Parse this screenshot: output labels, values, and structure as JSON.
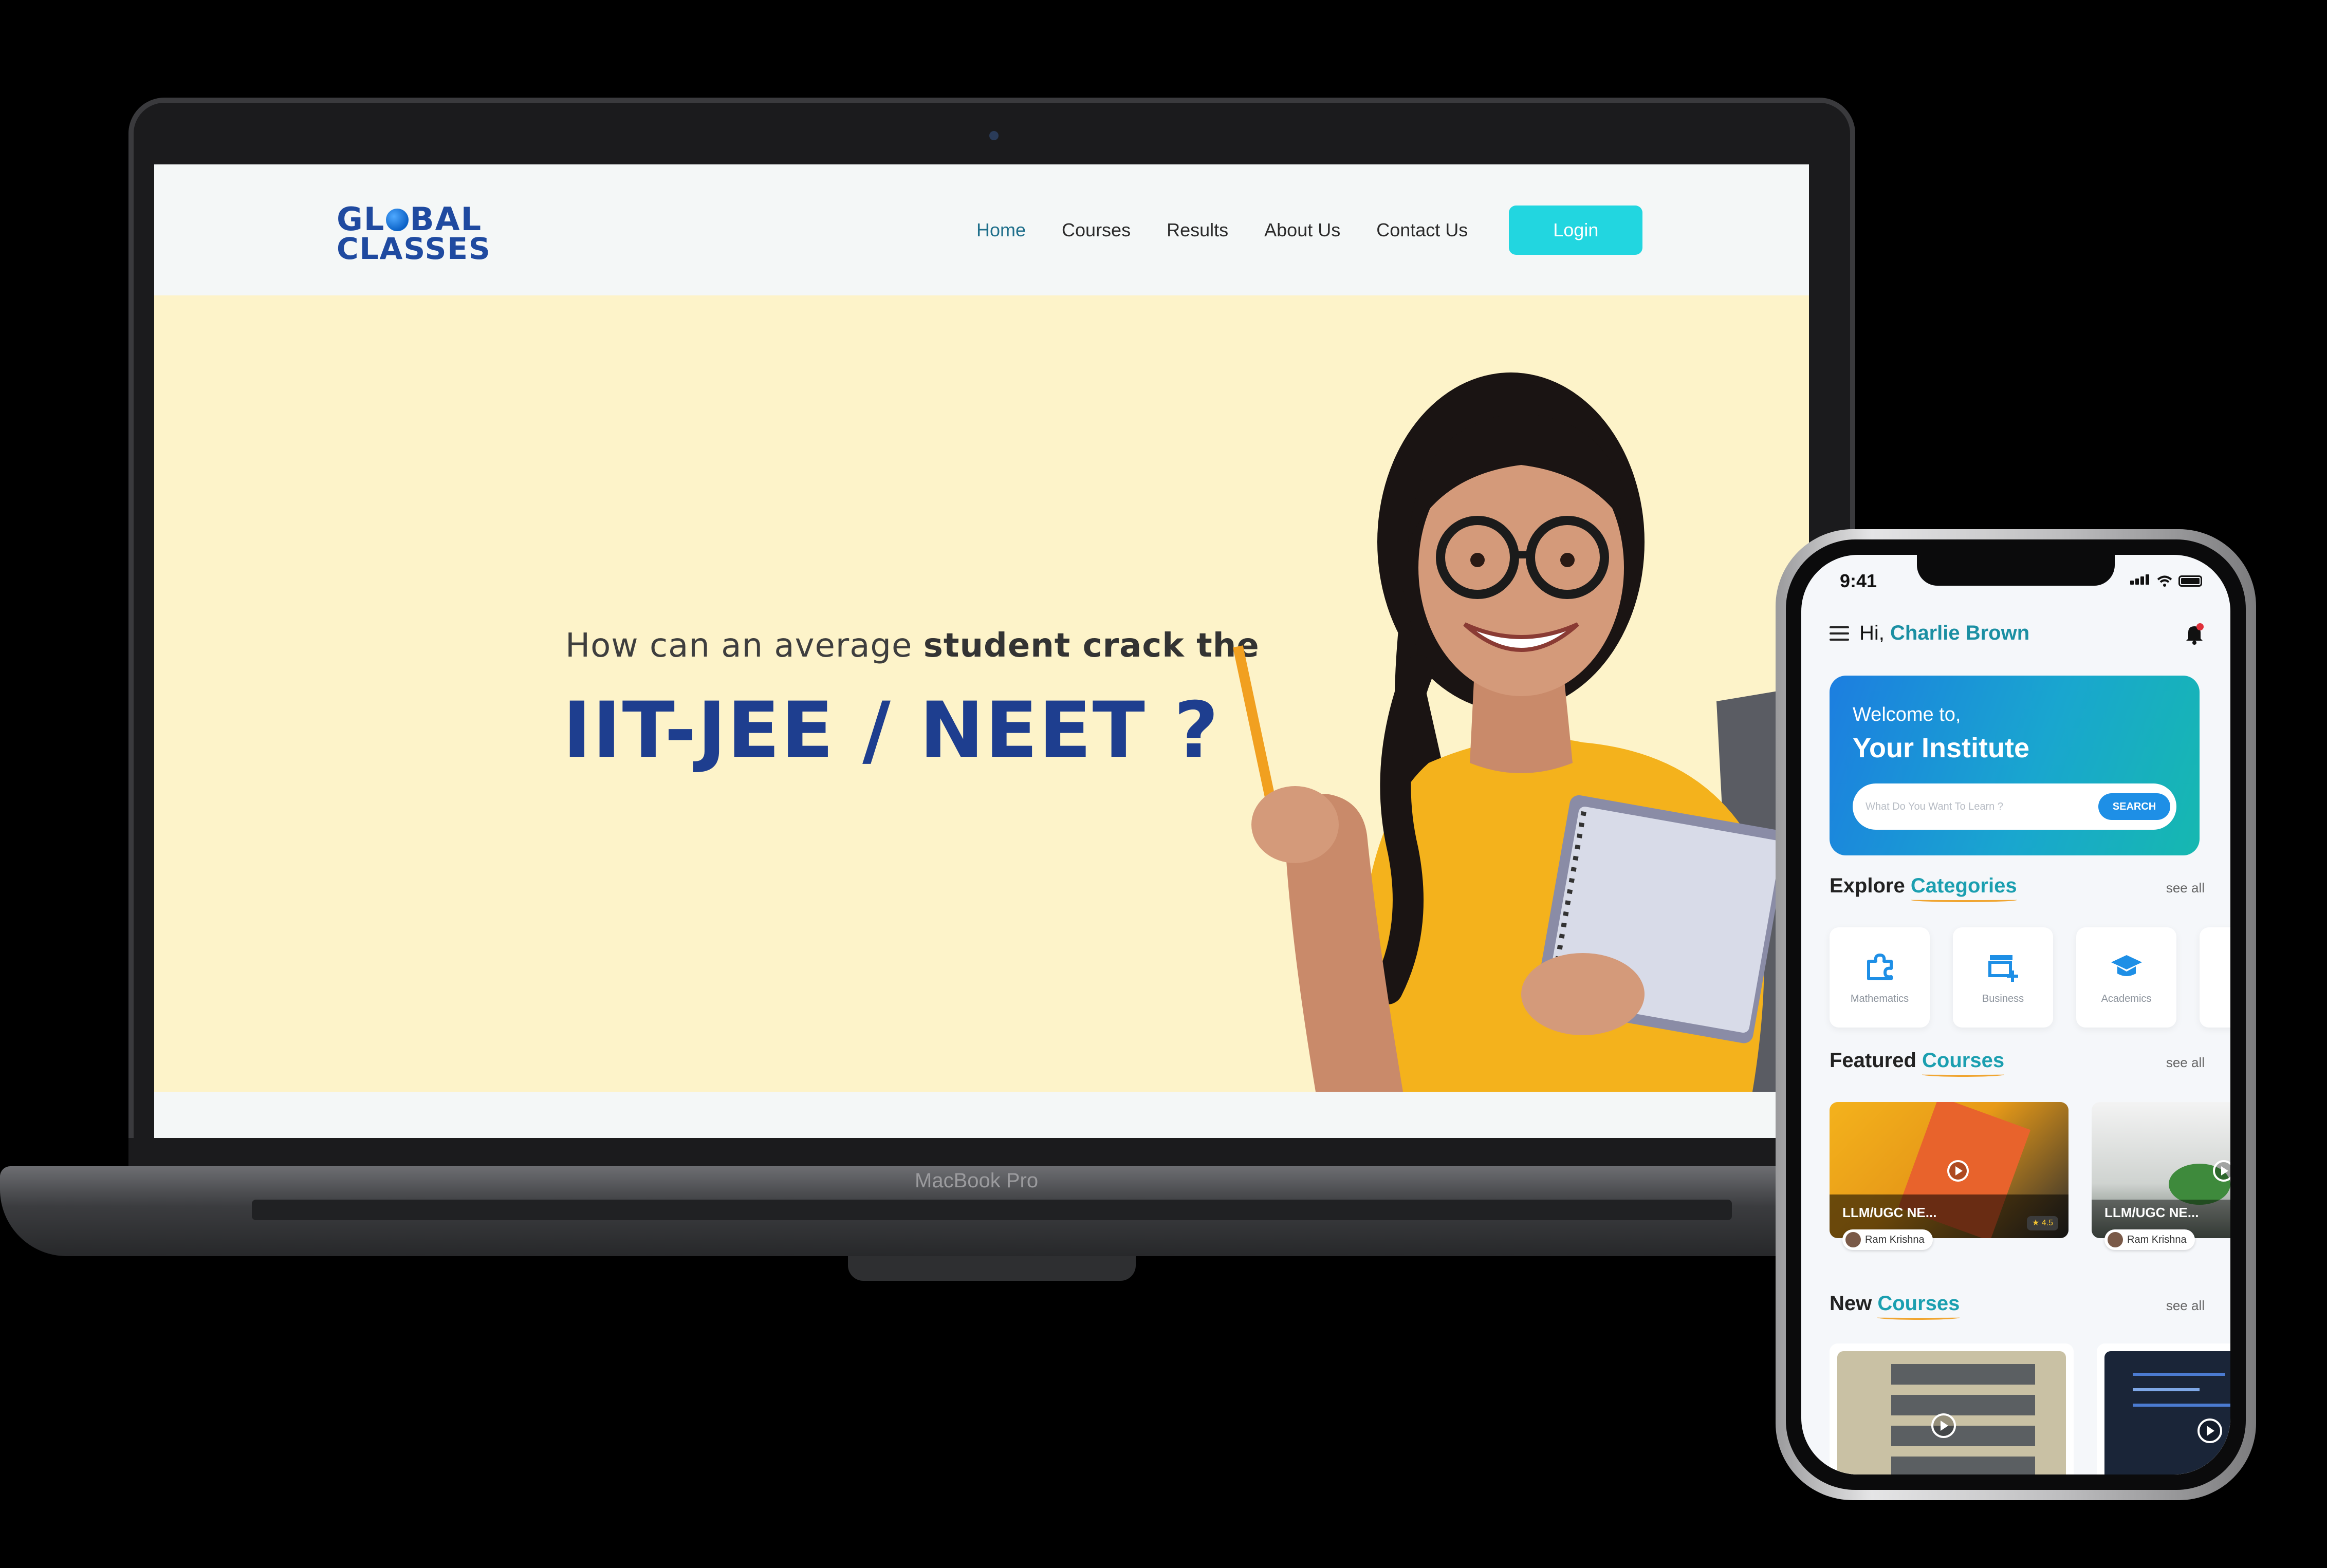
{
  "laptop": {
    "brand": "MacBook Pro",
    "site": {
      "logo_line1_a": "GL",
      "logo_line1_b": "BAL",
      "logo_line2": "CLASSES",
      "nav": [
        "Home",
        "Courses",
        "Results",
        "About Us",
        "Contact Us"
      ],
      "active_nav": "Home",
      "login_label": "Login",
      "hero_sub_plain": "How can an average ",
      "hero_sub_bold": "student crack the",
      "hero_title": "IIT-JEE / NEET ?"
    }
  },
  "phone": {
    "status_time": "9:41",
    "greeting_prefix": "Hi, ",
    "greeting_name": "Charlie Brown",
    "welcome_small": "Welcome to,",
    "welcome_big": "Your Institute",
    "search_placeholder": "What Do You Want To Learn ?",
    "search_button": "SEARCH",
    "sections": {
      "categories": {
        "prefix": "Explore ",
        "accent": "Categories",
        "see_all": "see all"
      },
      "featured": {
        "prefix": "Featured ",
        "accent": "Courses",
        "see_all": "see all"
      },
      "new": {
        "prefix": "New ",
        "accent": "Courses",
        "see_all": "see all"
      }
    },
    "categories": [
      "Mathematics",
      "Business",
      "Academics"
    ],
    "featured_courses": [
      {
        "title": "LLM/UGC NE...",
        "author": "Ram Krishna",
        "rating": "★ 4.5"
      },
      {
        "title": "LLM/UGC NE...",
        "author": "Ram Krishna"
      }
    ],
    "colors": {
      "accent": "#1b9fb0",
      "underline": "#f0a531",
      "login": "#22d6e0",
      "hero_title": "#1e3e8f"
    }
  }
}
